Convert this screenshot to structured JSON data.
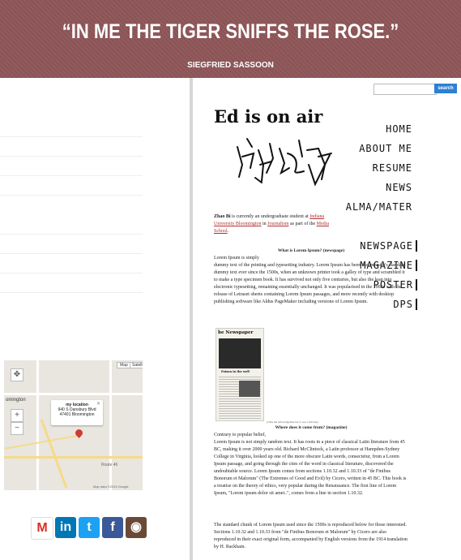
{
  "header": {
    "quote": "“IN ME THE TIGER SNIFFS THE ROSE.”",
    "author": "SIEGFRIED SASSOON"
  },
  "nav": {
    "primary": [
      "HOME",
      "ABOUT ME",
      "RESUME",
      "NEWS",
      "ALMA/MATER"
    ],
    "secondary": [
      "NEWSPAGE",
      "MAGAZINE",
      "POSTER",
      "DPS"
    ]
  },
  "map": {
    "info_title": "my location",
    "info_line1": "940 S Dansbury Blvd",
    "info_line2": "47401 Bloomington",
    "map_button": "Map",
    "satellite_button": "Satellite",
    "town_label": "omington",
    "route_label": "Route 46",
    "footer": "Map data ©2015 Google"
  },
  "social": [
    "gmail-icon",
    "linkedin-icon",
    "twitter-icon",
    "facebook-icon",
    "instagram-icon"
  ],
  "search": {
    "placeholder": "",
    "button_label": "search"
  },
  "main": {
    "title": "Ed is on air",
    "intro_name": "Zhao Bi",
    "intro_text1": " is currently an undergraduate student at ",
    "intro_link1": "Indiana University Bloomington",
    "intro_text2": " in ",
    "intro_link2": "Journalism",
    "intro_text3": " as part of the ",
    "intro_link3": "Media School",
    "intro_text4": ".",
    "section1_heading": "What is Lorem Ipsum? (newspage)",
    "section1_lead": "Lorem Ipsum is simply",
    "section1_body": "dummy text of the printing and typesetting industry. Lorem Ipsum has been the industry's standard dummy text ever since the 1500s, when an unknown printer took a galley of type and scrambled it to make a type specimen book. It has survived not only five centuries, but also the leap into electronic typesetting, remaining essentially unchanged. It was popularised in the 1960s with the release of Letraset sheets containing Lorem Ipsum passages, and more recently with desktop publishing software like Aldus PageMaker including versions of Lorem Ipsum.",
    "newspaper_masthead": "he Newspaper",
    "newspaper_subhead": "Poison in the well",
    "caption": "(click the left navigation bar to see a full site)",
    "section2_heading": "Where does it come from? (magazine)",
    "section2_lead": "Contrary to popular belief,",
    "section2_body": "Lorem Ipsum is not simply random text. It has roots in a piece of classical Latin literature from 45 BC, making it over 2000 years old. Richard McClintock, a Latin professor at Hampden-Sydney College in Virginia, looked up one of the more obscure Latin words, consectetur, from a Lorem Ipsum passage, and going through the cites of the word in classical literature, discovered the undoubtable source. Lorem Ipsum comes from sections 1.10.32 and 1.10.33 of \"de Finibus Bonorum et Malorum\" (The Extremes of Good and Evil) by Cicero, written in 45 BC. This book is a treatise on the theory of ethics, very popular during the Renaissance. The first line of Lorem Ipsum, \"Lorem ipsum dolor sit amet..\", comes from a line in section 1.10.32.",
    "section3_body": "The standard chunk of Lorem Ipsum used since the 1500s is reproduced below for those interested. Sections 1.10.32 and 1.10.33 from \"de Finibus Bonorum et Malorum\" by Cicero are also reproduced in their exact original form, accompanied by English versions from the 1914 translation by H. Rackham."
  },
  "colors": {
    "banner": "#8e5658",
    "link": "#b03030",
    "search_button": "#2f7fd3"
  }
}
